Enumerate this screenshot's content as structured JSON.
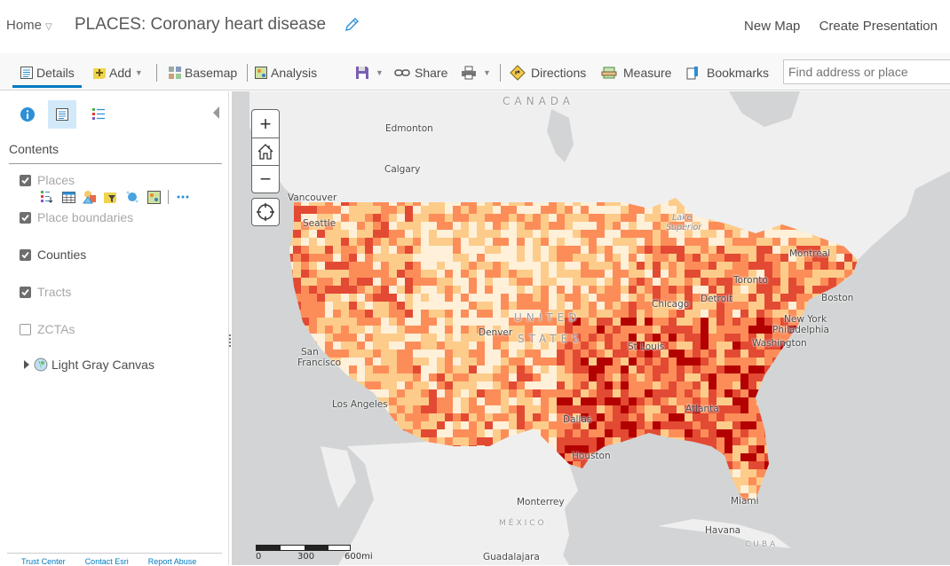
{
  "header": {
    "home_label": "Home",
    "title": "PLACES: Coronary heart disease",
    "links": [
      "New Map",
      "Create Presentation"
    ]
  },
  "toolbar": {
    "details": "Details",
    "add": "Add",
    "basemap": "Basemap",
    "analysis": "Analysis",
    "share": "Share",
    "directions": "Directions",
    "measure": "Measure",
    "bookmarks": "Bookmarks",
    "search_placeholder": "Find address or place"
  },
  "sidebar": {
    "tabs": [
      "about-icon",
      "contents-icon",
      "legend-icon"
    ],
    "active_tab": "contents",
    "contents_label": "Contents",
    "layers": [
      {
        "label": "Places",
        "checked": true,
        "dimmed": true
      },
      {
        "label": "Place boundaries",
        "checked": true,
        "dimmed": true
      },
      {
        "label": "Counties",
        "checked": true,
        "dimmed": false
      },
      {
        "label": "Tracts",
        "checked": true,
        "dimmed": true
      },
      {
        "label": "ZCTAs",
        "checked": false,
        "dimmed": true
      }
    ],
    "layer_tools": [
      "show-legend-icon",
      "show-table-icon",
      "change-style-icon",
      "filter-icon",
      "perform-analysis-icon",
      "show-analysis-icon",
      "more-options-icon"
    ],
    "basemap_label": "Light Gray Canvas",
    "footer_links": [
      "Trust Center",
      "Contact Esri",
      "Report Abuse"
    ]
  },
  "map": {
    "labels": {
      "canada": "CANADA",
      "united": "UNITED",
      "states": "STATES",
      "mexico": "MÉXICO",
      "cuba": "CUBA",
      "lake_superior_1": "Lake",
      "lake_superior_2": "Superior",
      "edmonton": "Edmonton",
      "calgary": "Calgary",
      "vancouver": "Vancouver",
      "seattle": "Seattle",
      "san_francisco_1": "San",
      "san_francisco_2": "Francisco",
      "los_angeles": "Los Angeles",
      "denver": "Denver",
      "dallas": "Dallas",
      "houston": "Houston",
      "st_louis": "St Louis",
      "chicago": "Chicago",
      "detroit": "Detroit",
      "toronto": "Toronto",
      "montreal": "Montreal",
      "boston": "Boston",
      "new_york": "New York",
      "philadelphia": "Philadelphia",
      "washington": "Washington",
      "atlanta": "Atlanta",
      "miami": "Miami",
      "havana": "Havana",
      "monterrey": "Monterrey",
      "guadalajara": "Guadalajara"
    },
    "scale": {
      "ticks": [
        "0",
        "300",
        "600mi"
      ]
    },
    "choropleth_colors": [
      "#fef0d9",
      "#fdcc8a",
      "#fc8d59",
      "#e34a33",
      "#b30000"
    ]
  }
}
